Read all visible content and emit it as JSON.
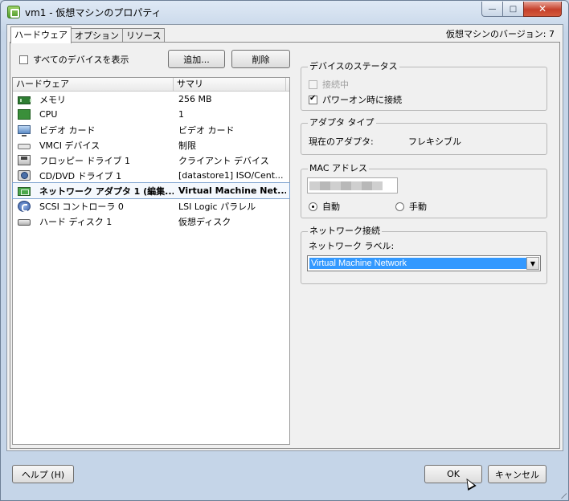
{
  "window": {
    "title": "vm1 - 仮想マシンのプロパティ",
    "controls": {
      "minimize": "—",
      "maximize": "□",
      "close": "✕"
    }
  },
  "tabs": [
    "ハードウェア",
    "オプション",
    "リソース"
  ],
  "version_label": "仮想マシンのバージョン: 7",
  "hardware_panel": {
    "show_all_devices": {
      "label": "すべてのデバイスを表示",
      "checked": false
    },
    "add_button": "追加...",
    "remove_button": "削除",
    "columns": [
      "ハードウェア",
      "サマリ"
    ],
    "rows": [
      {
        "icon": "memory-icon",
        "name": "メモリ",
        "summary": "256 MB",
        "selected": false
      },
      {
        "icon": "cpu-icon",
        "name": "CPU",
        "summary": "1",
        "selected": false
      },
      {
        "icon": "video-card-icon",
        "name": "ビデオ カード",
        "summary": "ビデオ カード",
        "selected": false
      },
      {
        "icon": "vmci-icon",
        "name": "VMCI デバイス",
        "summary": "制限",
        "selected": false
      },
      {
        "icon": "floppy-icon",
        "name": "フロッピー ドライブ 1",
        "summary": "クライアント デバイス",
        "selected": false
      },
      {
        "icon": "cd-dvd-icon",
        "name": "CD/DVD ドライブ 1",
        "summary": "[datastore1] ISO/Cent...",
        "selected": false
      },
      {
        "icon": "network-adapter-icon",
        "name": "ネットワーク アダプタ 1 (編集...",
        "summary": "Virtual Machine Net...",
        "selected": true
      },
      {
        "icon": "scsi-controller-icon",
        "name": "SCSI コントローラ 0",
        "summary": "LSI Logic パラレル",
        "selected": false
      },
      {
        "icon": "hard-disk-icon",
        "name": "ハード ディスク 1",
        "summary": "仮想ディスク",
        "selected": false
      }
    ]
  },
  "device_status": {
    "legend": "デバイスのステータス",
    "connected": {
      "label": "接続中",
      "checked": false,
      "disabled": true
    },
    "connect_at_power_on": {
      "label": "パワーオン時に接続",
      "checked": true
    }
  },
  "adapter_type": {
    "legend": "アダプタ タイプ",
    "current_label": "現在のアダプタ:",
    "current_value": "フレキシブル"
  },
  "mac_address": {
    "legend": "MAC アドレス",
    "auto_label": "自動",
    "manual_label": "手動",
    "mode": "auto"
  },
  "network_connection": {
    "legend": "ネットワーク接続",
    "label_caption": "ネットワーク ラベル:",
    "selected": "Virtual Machine Network"
  },
  "footer": {
    "help_button": "ヘルプ (H)",
    "ok_button": "OK",
    "cancel_button": "キャンセル"
  },
  "colors": {
    "selection": "#3399ff",
    "window_frame": "#c5d5e8",
    "close_button": "#c5402b"
  }
}
